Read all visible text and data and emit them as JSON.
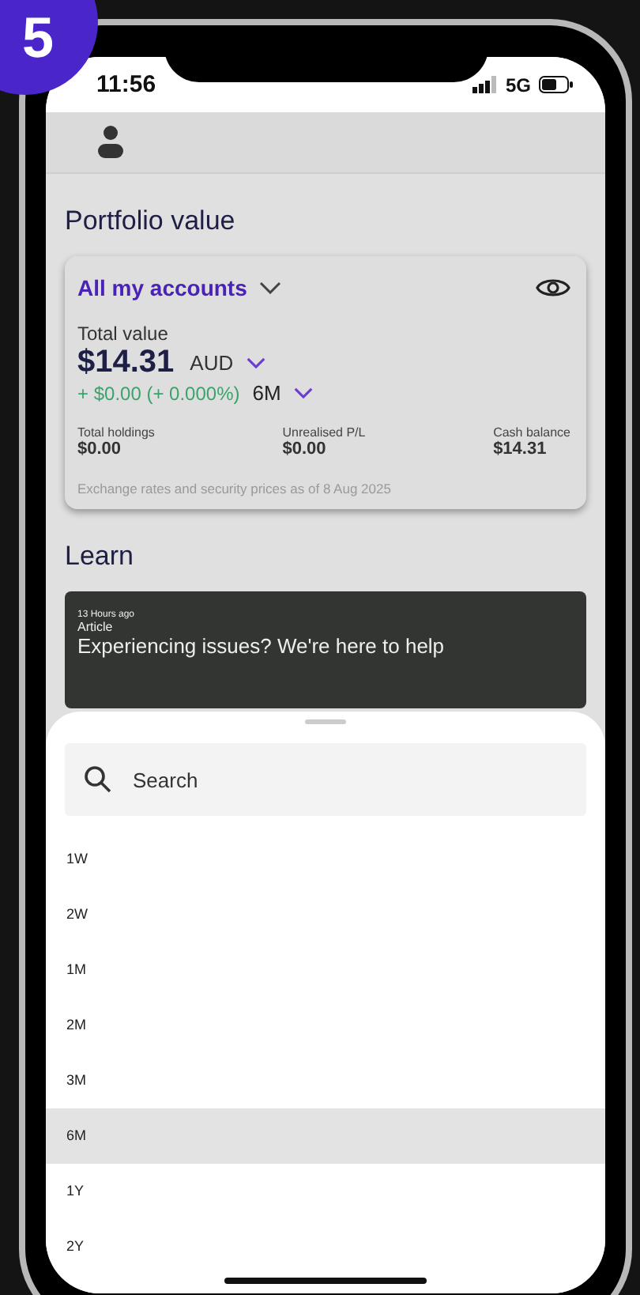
{
  "step_badge": "5",
  "status_bar": {
    "time": "11:56",
    "network": "5G"
  },
  "portfolio": {
    "title": "Portfolio value",
    "account_selector": "All my accounts",
    "total_label": "Total value",
    "total_value": "$14.31",
    "currency": "AUD",
    "change": "+ $0.00 (+ 0.000%)",
    "period": "6M",
    "stats": [
      {
        "label": "Total holdings",
        "value": "$0.00"
      },
      {
        "label": "Unrealised P/L",
        "value": "$0.00"
      },
      {
        "label": "Cash balance",
        "value": "$14.31"
      }
    ],
    "footnote": "Exchange rates and security prices as of 8 Aug 2025"
  },
  "learn": {
    "title": "Learn",
    "article": {
      "time": "13 Hours ago",
      "type": "Article",
      "title": "Experiencing issues? We're here to help"
    }
  },
  "sheet": {
    "search": {
      "placeholder": "Search"
    },
    "options": [
      {
        "label": "1W",
        "selected": false
      },
      {
        "label": "2W",
        "selected": false
      },
      {
        "label": "1M",
        "selected": false
      },
      {
        "label": "2M",
        "selected": false
      },
      {
        "label": "3M",
        "selected": false
      },
      {
        "label": "6M",
        "selected": true
      },
      {
        "label": "1Y",
        "selected": false
      },
      {
        "label": "2Y",
        "selected": false
      }
    ]
  }
}
